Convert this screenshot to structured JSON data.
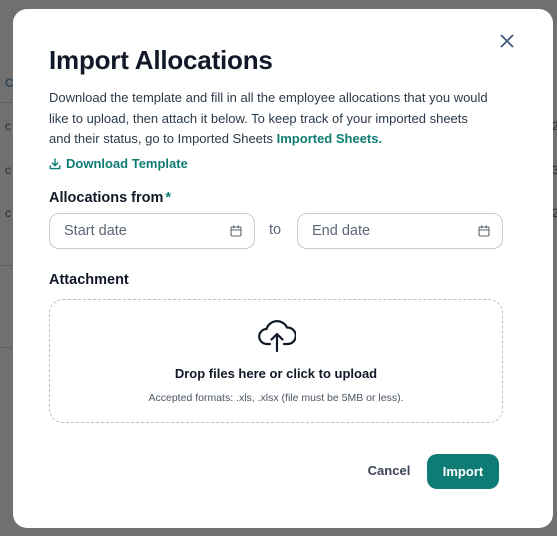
{
  "modal": {
    "title": "Import Allocations",
    "description_text": "Download the template and fill in all the employee allocations that you would like to upload, then attach it below. To keep track of your imported sheets and their status, go to Imported Sheets ",
    "description_link": "Imported Sheets.",
    "download_label": "Download Template",
    "allocations_label": "Allocations from",
    "required_mark": "*",
    "start_date_placeholder": "Start date",
    "to_label": "to",
    "end_date_placeholder": "End date",
    "attachment_label": "Attachment",
    "dropzone_title": "Drop files here or click to upload",
    "dropzone_hint": "Accepted formats: .xls, .xlsx (file must be 5MB or less).",
    "cancel_label": "Cancel",
    "import_label": "Import"
  },
  "background": {
    "left_chars": [
      "C",
      "c",
      "c",
      "c"
    ],
    "right_chars": [
      "2",
      "3",
      "2"
    ]
  },
  "colors": {
    "accent": "#0e7c74",
    "overlay": "#707070",
    "text_dark": "#111827"
  },
  "icons": [
    "close-icon",
    "download-icon",
    "calendar-icon",
    "upload-cloud-icon"
  ]
}
